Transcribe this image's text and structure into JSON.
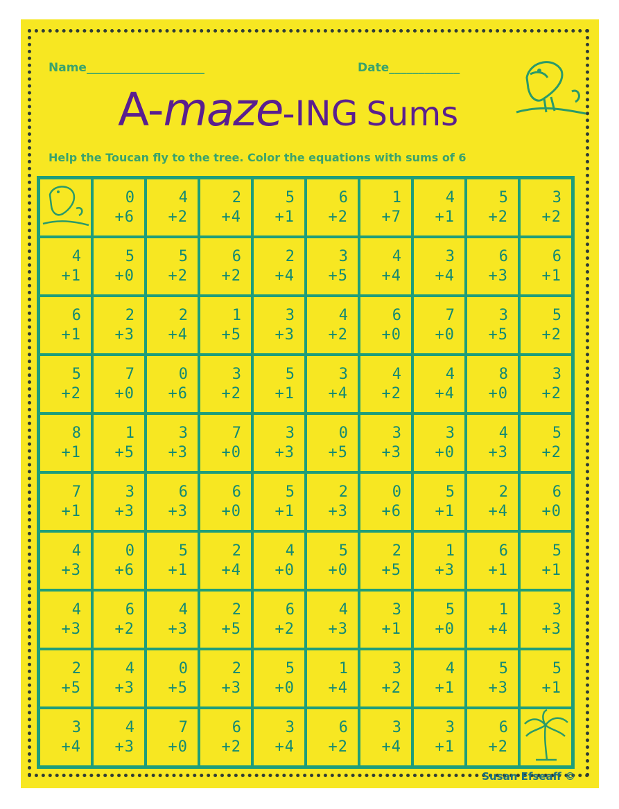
{
  "header": {
    "name_label": "Name____________________",
    "date_label": "Date____________",
    "title_part1": "A-",
    "title_part2": "maze",
    "title_part3": "-ING",
    "title_part4": "Sums",
    "instructions": "Help the Toucan fly to the tree. Color the equations with sums of 6"
  },
  "grid": [
    [
      "",
      "0|+6",
      "4|+2",
      "2|+4",
      "5|+1",
      "6|+2",
      "1|+7",
      "4|+1",
      "5|+2",
      "3|+2"
    ],
    [
      "4|+1",
      "5|+0",
      "5|+2",
      "6|+2",
      "2|+4",
      "3|+5",
      "4|+4",
      "3|+4",
      "6|+3",
      "6|+1"
    ],
    [
      "6|+1",
      "2|+3",
      "2|+4",
      "1|+5",
      "3|+3",
      "4|+2",
      "6|+0",
      "7|+0",
      "3|+5",
      "5|+2"
    ],
    [
      "5|+2",
      "7|+0",
      "0|+6",
      "3|+2",
      "5|+1",
      "3|+4",
      "4|+2",
      "4|+4",
      "8|+0",
      "3|+2"
    ],
    [
      "8|+1",
      "1|+5",
      "3|+3",
      "7|+0",
      "3|+3",
      "0|+5",
      "3|+3",
      "3|+0",
      "4|+3",
      "5|+2"
    ],
    [
      "7|+1",
      "3|+3",
      "6|+3",
      "6|+0",
      "5|+1",
      "2|+3",
      "0|+6",
      "5|+1",
      "2|+4",
      "6|+0"
    ],
    [
      "4|+3",
      "0|+6",
      "5|+1",
      "2|+4",
      "4|+0",
      "5|+0",
      "2|+5",
      "1|+3",
      "6|+1",
      "5|+1"
    ],
    [
      "4|+3",
      "6|+2",
      "4|+3",
      "2|+5",
      "6|+2",
      "4|+3",
      "3|+1",
      "5|+0",
      "1|+4",
      "3|+3"
    ],
    [
      "2|+5",
      "4|+3",
      "0|+5",
      "2|+3",
      "5|+0",
      "1|+4",
      "3|+2",
      "4|+1",
      "5|+3",
      "5|+1"
    ],
    [
      "3|+4",
      "4|+3",
      "7|+0",
      "6|+2",
      "3|+4",
      "6|+2",
      "3|+4",
      "3|+1",
      "6|+2",
      ""
    ]
  ],
  "credit": "Susan Efseaff ©",
  "colors": {
    "background": "#f7e722",
    "grid": "#1e9e7a",
    "title": "#5a1f8f",
    "text": "#3aa36c"
  }
}
